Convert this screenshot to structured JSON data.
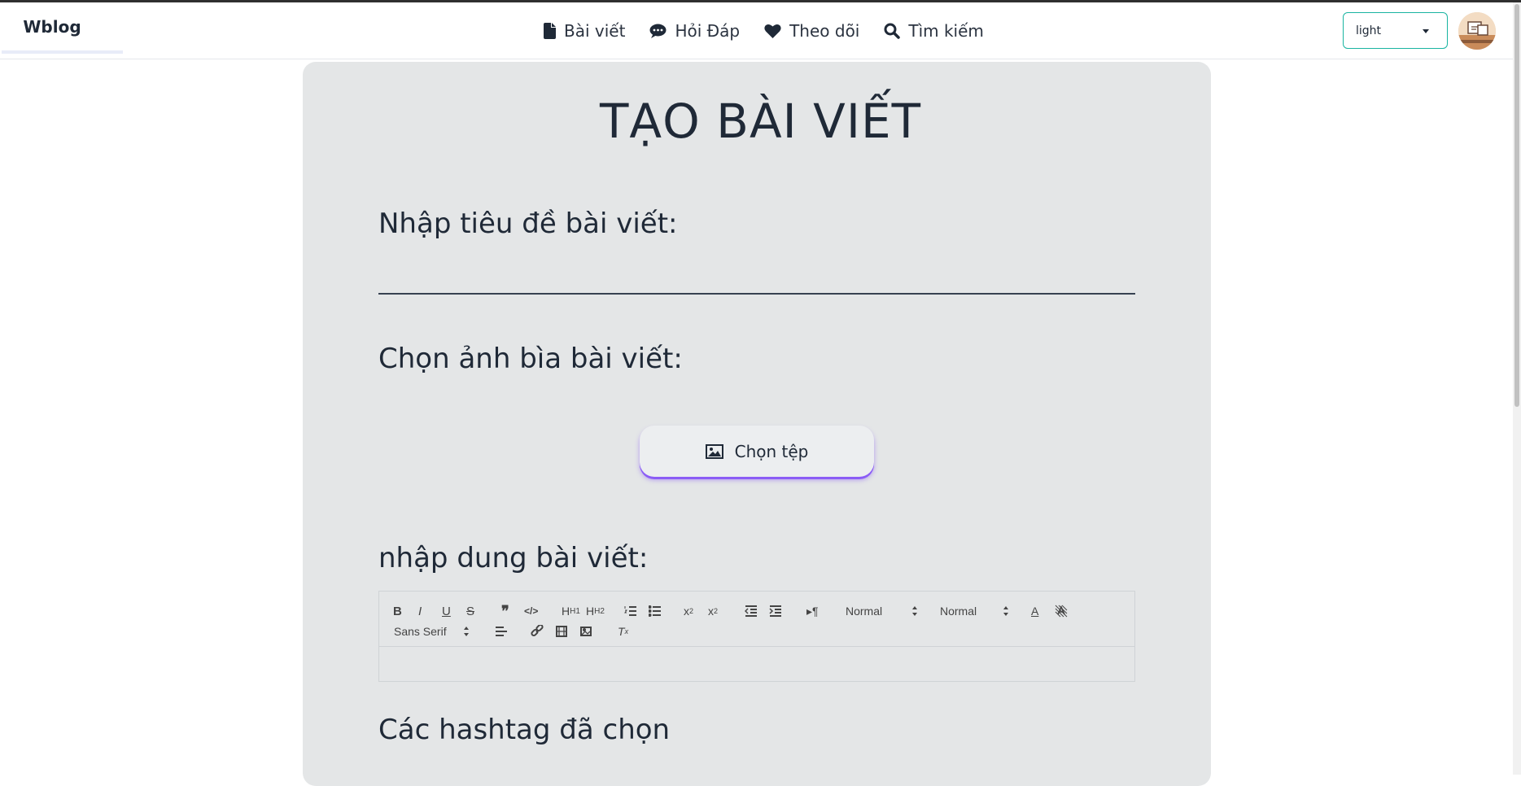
{
  "brand": "Wblog",
  "nav": [
    {
      "label": "Bài viết",
      "icon": "file-icon"
    },
    {
      "label": "Hỏi Đáp",
      "icon": "comment-dots-icon"
    },
    {
      "label": "Theo dõi",
      "icon": "heart-icon"
    },
    {
      "label": "Tìm kiếm",
      "icon": "search-icon"
    }
  ],
  "theme": {
    "selected": "light"
  },
  "page": {
    "title": "TẠO BÀI VIẾT",
    "title_label": "Nhập tiêu đề bài viết:",
    "title_value": "",
    "cover_label": "Chọn ảnh bìa bài viết:",
    "file_button": "Chọn tệp",
    "content_label": "nhập dung bài viết:",
    "hashtag_label": "Các hashtag đã chọn"
  },
  "editor": {
    "header_select": "Normal",
    "size_select": "Normal",
    "font_select": "Sans Serif",
    "h1": "H1",
    "h2": "H2"
  },
  "colors": {
    "accent": "#8b5cf6",
    "select_border": "#19b4a1",
    "card_bg": "#e4e6e7"
  }
}
